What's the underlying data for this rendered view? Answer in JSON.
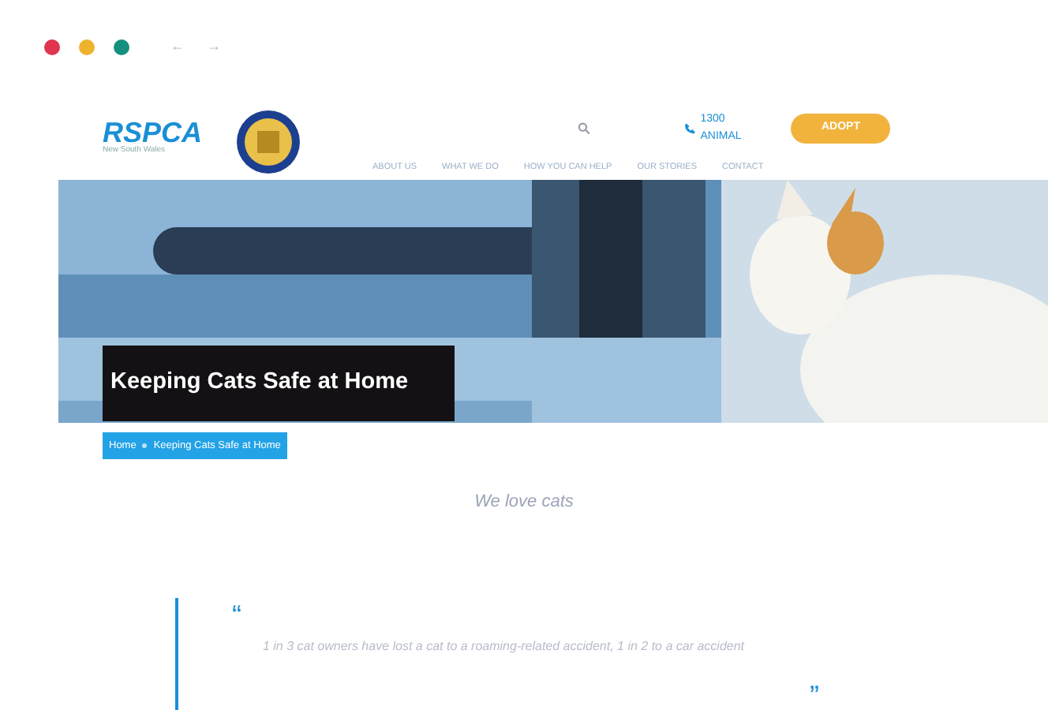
{
  "browser": {
    "controls": [
      {
        "color": "#e0344f"
      },
      {
        "color": "#efb22e"
      },
      {
        "color": "#14907f"
      }
    ],
    "back": "←",
    "forward": "→"
  },
  "header": {
    "logo": "RSPCA",
    "logo_tagline": "New South Wales",
    "phone": "1300 ANIMAL",
    "adopt_button": "ADOPT",
    "nav": [
      "ABOUT US",
      "WHAT WE DO",
      "HOW YOU CAN HELP",
      "OUR STORIES",
      "CONTACT"
    ]
  },
  "hero": {
    "kind": "picture",
    "title": "Keeping Cats Safe at Home"
  },
  "breadcrumb": [
    "Home",
    "Keeping Cats Safe at Home"
  ],
  "section_title": "We love cats",
  "quote": {
    "open": "“",
    "text": "1 in 3 cat owners have lost a cat to a roaming-related accident, 1 in 2 to a car accident",
    "close": "”"
  }
}
